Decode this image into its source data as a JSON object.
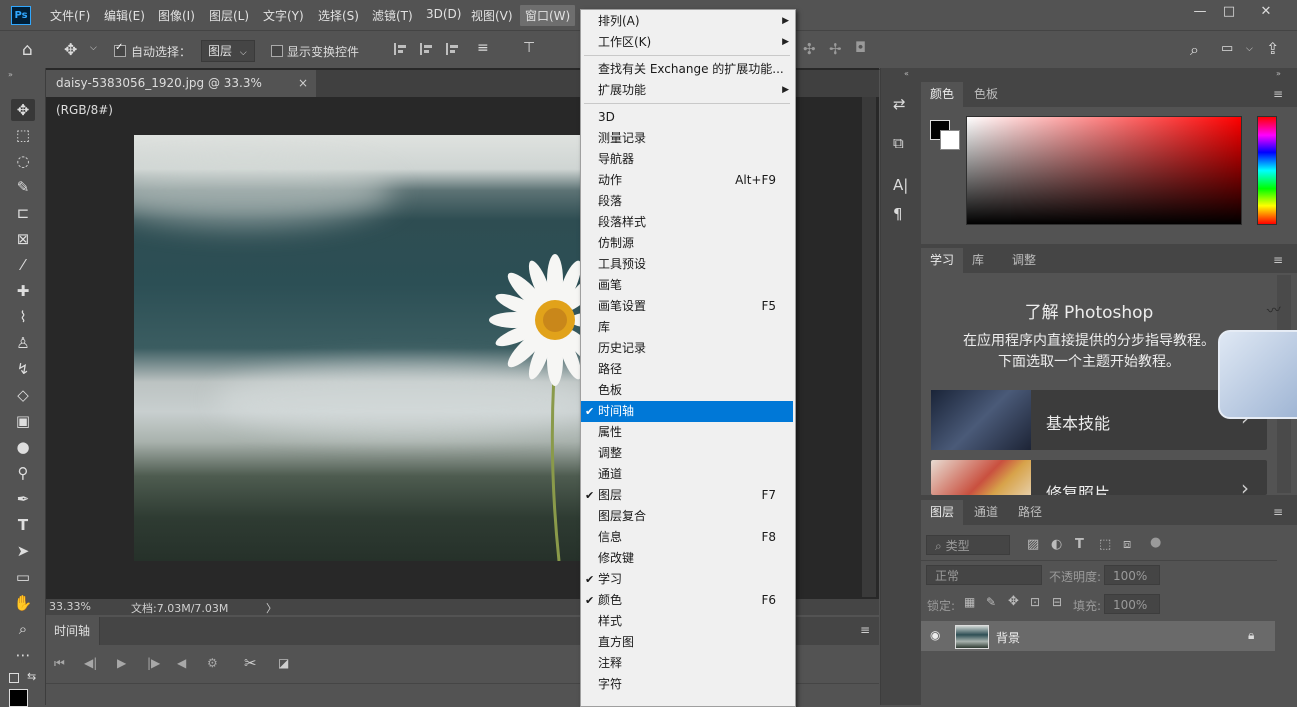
{
  "menubar": {
    "logo": "Ps",
    "items": [
      "文件(F)",
      "编辑(E)",
      "图像(I)",
      "图层(L)",
      "文字(Y)",
      "选择(S)",
      "滤镜(T)",
      "3D(D)",
      "视图(V)",
      "窗口(W)"
    ],
    "window_buttons": [
      "—",
      "□",
      "✕"
    ]
  },
  "options": {
    "auto_select_label": "自动选择：",
    "auto_select_value": "图层",
    "show_transform_label": "显示变换控件"
  },
  "document": {
    "tab_title": "daisy-5383056_1920.jpg @ 33.3%(RGB/8#)",
    "tab_close": "×",
    "zoom": "33.33%",
    "doc_info": "文档:7.03M/7.03M",
    "status_arrow": "〉"
  },
  "timeline": {
    "tab": "时间轴",
    "buttons": [
      "⏮",
      "◀|",
      "▶",
      "|▶",
      "◀",
      "⚙",
      "✂",
      "◪"
    ]
  },
  "color_panel": {
    "tabs": [
      "颜色",
      "色板"
    ],
    "foreground": "#000000",
    "background": "#ffffff"
  },
  "learn_panel": {
    "tabs": [
      "学习",
      "库",
      "调整"
    ],
    "title": "了解 Photoshop",
    "subtitle_line1": "在应用程序内直接提供的分步指导教程。",
    "subtitle_line2": "下面选取一个主题开始教程。",
    "cards": [
      {
        "label": "基本技能"
      },
      {
        "label": "修复照片"
      }
    ]
  },
  "layers_panel": {
    "tabs": [
      "图层",
      "通道",
      "路径"
    ],
    "filter_placeholder": "类型",
    "blend_mode": "正常",
    "opacity_label": "不透明度:",
    "opacity_value": "100%",
    "lock_label": "锁定:",
    "fill_label": "填充:",
    "fill_value": "100%",
    "layer_name": "背景"
  },
  "window_menu": {
    "items": [
      {
        "label": "排列(A)",
        "submenu": true
      },
      {
        "label": "工作区(K)",
        "submenu": true
      },
      {
        "separator": true
      },
      {
        "label": "查找有关 Exchange 的扩展功能..."
      },
      {
        "label": "扩展功能",
        "submenu": true
      },
      {
        "separator": true
      },
      {
        "label": "3D"
      },
      {
        "label": "测量记录"
      },
      {
        "label": "导航器"
      },
      {
        "label": "动作",
        "shortcut": "Alt+F9"
      },
      {
        "label": "段落"
      },
      {
        "label": "段落样式"
      },
      {
        "label": "仿制源"
      },
      {
        "label": "工具预设"
      },
      {
        "label": "画笔"
      },
      {
        "label": "画笔设置",
        "shortcut": "F5"
      },
      {
        "label": "库"
      },
      {
        "label": "历史记录"
      },
      {
        "label": "路径"
      },
      {
        "label": "色板"
      },
      {
        "label": "时间轴",
        "checked": true,
        "highlighted": true
      },
      {
        "label": "属性"
      },
      {
        "label": "调整"
      },
      {
        "label": "通道"
      },
      {
        "label": "图层",
        "checked": true,
        "shortcut": "F7"
      },
      {
        "label": "图层复合"
      },
      {
        "label": "信息",
        "shortcut": "F8"
      },
      {
        "label": "修改键"
      },
      {
        "label": "学习",
        "checked": true
      },
      {
        "label": "颜色",
        "checked": true,
        "shortcut": "F6"
      },
      {
        "label": "样式"
      },
      {
        "label": "直方图"
      },
      {
        "label": "注释"
      },
      {
        "label": "字符"
      }
    ]
  }
}
